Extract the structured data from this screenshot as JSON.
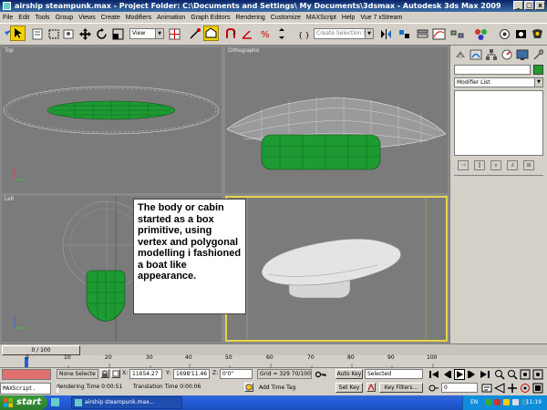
{
  "window": {
    "title": "airship steampunk.max    - Project Folder: C:\\Documents and Settings\\          My Documents\\3dsmax    - Autodesk 3ds Max  2009",
    "minimize": "_",
    "maximize": "□",
    "close": "x"
  },
  "menu": [
    "File",
    "Edit",
    "Tools",
    "Group",
    "Views",
    "Create",
    "Modifiers",
    "Animation",
    "Graph Editors",
    "Rendering",
    "Customize",
    "MAXScript",
    "Help",
    "Vue 7 xStream"
  ],
  "toolbar": {
    "view_combo": "View",
    "selection_set_placeholder": "Create Selection Set"
  },
  "viewports": {
    "top": "Top",
    "orthographic": "Orthographic",
    "left": "Left",
    "perspective": "ective"
  },
  "callout": "The body or cabin started as a box primitive, using vertex and polygonal modelling i fashioned a boat like appearance.",
  "command_panel": {
    "modifier_list": "Modifier List",
    "object_color": "#1d9c2d"
  },
  "time_slider": {
    "label": "0 / 100"
  },
  "trackbar": {
    "ticks": [
      "0",
      "10",
      "20",
      "30",
      "40",
      "50",
      "60",
      "70",
      "80",
      "90",
      "100"
    ]
  },
  "status": {
    "selection": "None Selecte",
    "x_label": "X:",
    "x_value": "11654.27",
    "y_label": "Y:",
    "y_value": "1698'11.46",
    "z_label": "Z:",
    "z_value": "0'0\"",
    "grid": "Grid = 329 70/100\"",
    "maxscript": "MAXScript.",
    "rendering_time": "Rendering Time  0:00:51",
    "translation_time": "Translation Time  0:00:06",
    "add_time_tag": "Add Time Tag",
    "auto_key": "Auto Key",
    "selected": "Selected",
    "set_key": "Set Key",
    "key_filters": "Key Filters...",
    "frame": "0"
  },
  "taskbar": {
    "start": "start",
    "task": "airship steampunk.max...",
    "lang": "EN",
    "clock": "11:19"
  },
  "colors": {
    "hull_green": "#1e9a32",
    "viewport_bg": "#7b7b7b",
    "active_border": "#e6d34a"
  }
}
